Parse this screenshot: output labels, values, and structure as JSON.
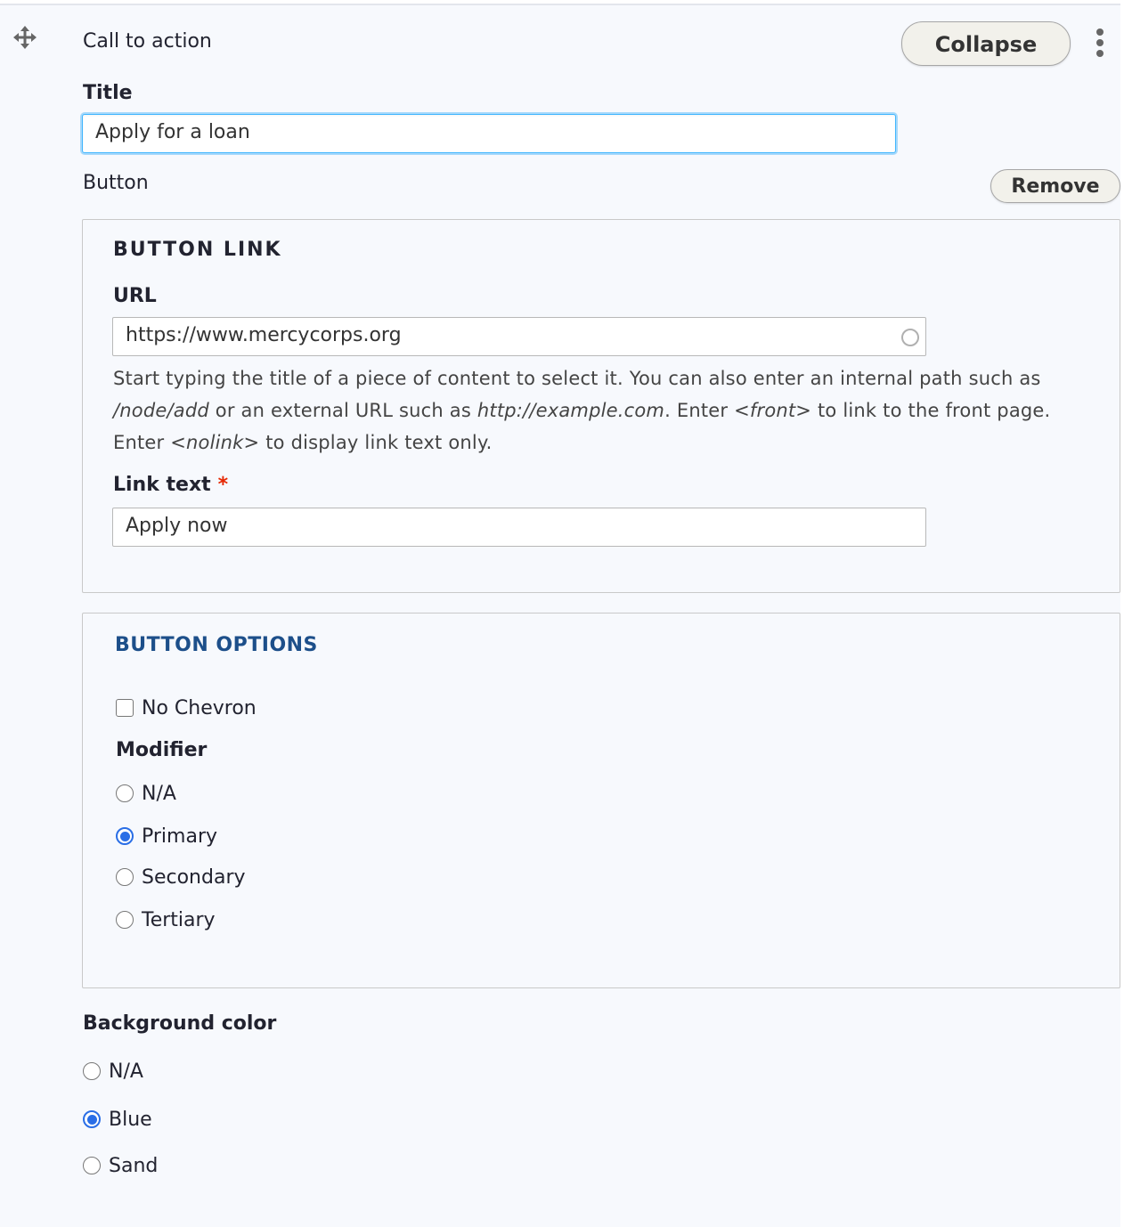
{
  "paragraph": {
    "type_label": "Call to action",
    "collapse_label": "Collapse",
    "drag_icon": "move-icon",
    "menu_icon": "kebab-menu-icon"
  },
  "title_field": {
    "label": "Title",
    "value": "Apply for a loan"
  },
  "button_section": {
    "label": "Button",
    "remove_label": "Remove"
  },
  "button_link": {
    "legend": "BUTTON LINK",
    "url_label": "URL",
    "url_value": "https://www.mercycorps.org",
    "description": {
      "part1": "Start typing the title of a piece of content to select it. You can also enter an internal path such as ",
      "em1": "/node/add",
      "part2": " or an external URL such as ",
      "em2": "http://example.com",
      "part3": ". Enter ",
      "em3": "<front>",
      "part4": " to link to the front page. Enter ",
      "em4": "<nolink>",
      "part5": " to display link text only."
    },
    "link_text_label": "Link text",
    "required_marker": "*",
    "link_text_value": "Apply now"
  },
  "button_options": {
    "legend": "BUTTON OPTIONS",
    "legend_color": "#1d4f8a",
    "no_chevron_label": "No Chevron",
    "no_chevron_checked": false,
    "modifier_label": "Modifier",
    "modifier_options": [
      "N/A",
      "Primary",
      "Secondary",
      "Tertiary"
    ],
    "modifier_selected": "Primary"
  },
  "background_color": {
    "label": "Background color",
    "options": [
      "N/A",
      "Blue",
      "Sand"
    ],
    "selected": "Blue"
  }
}
